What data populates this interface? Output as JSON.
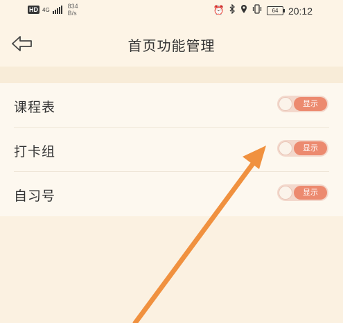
{
  "status_bar": {
    "hd": "HD",
    "network": "4G",
    "speed_value": "834",
    "speed_unit": "B/s",
    "battery": "64",
    "time": "20:12"
  },
  "header": {
    "title": "首页功能管理",
    "back_icon": "back-arrow-icon"
  },
  "features": [
    {
      "label": "课程表",
      "toggle_label": "显示"
    },
    {
      "label": "打卡组",
      "toggle_label": "显示"
    },
    {
      "label": "自习号",
      "toggle_label": "显示"
    }
  ],
  "colors": {
    "background": "#fbf1e1",
    "list_background": "#fdf8ef",
    "toggle_accent": "#ec8a6f",
    "annotation_arrow": "#f0913f"
  }
}
